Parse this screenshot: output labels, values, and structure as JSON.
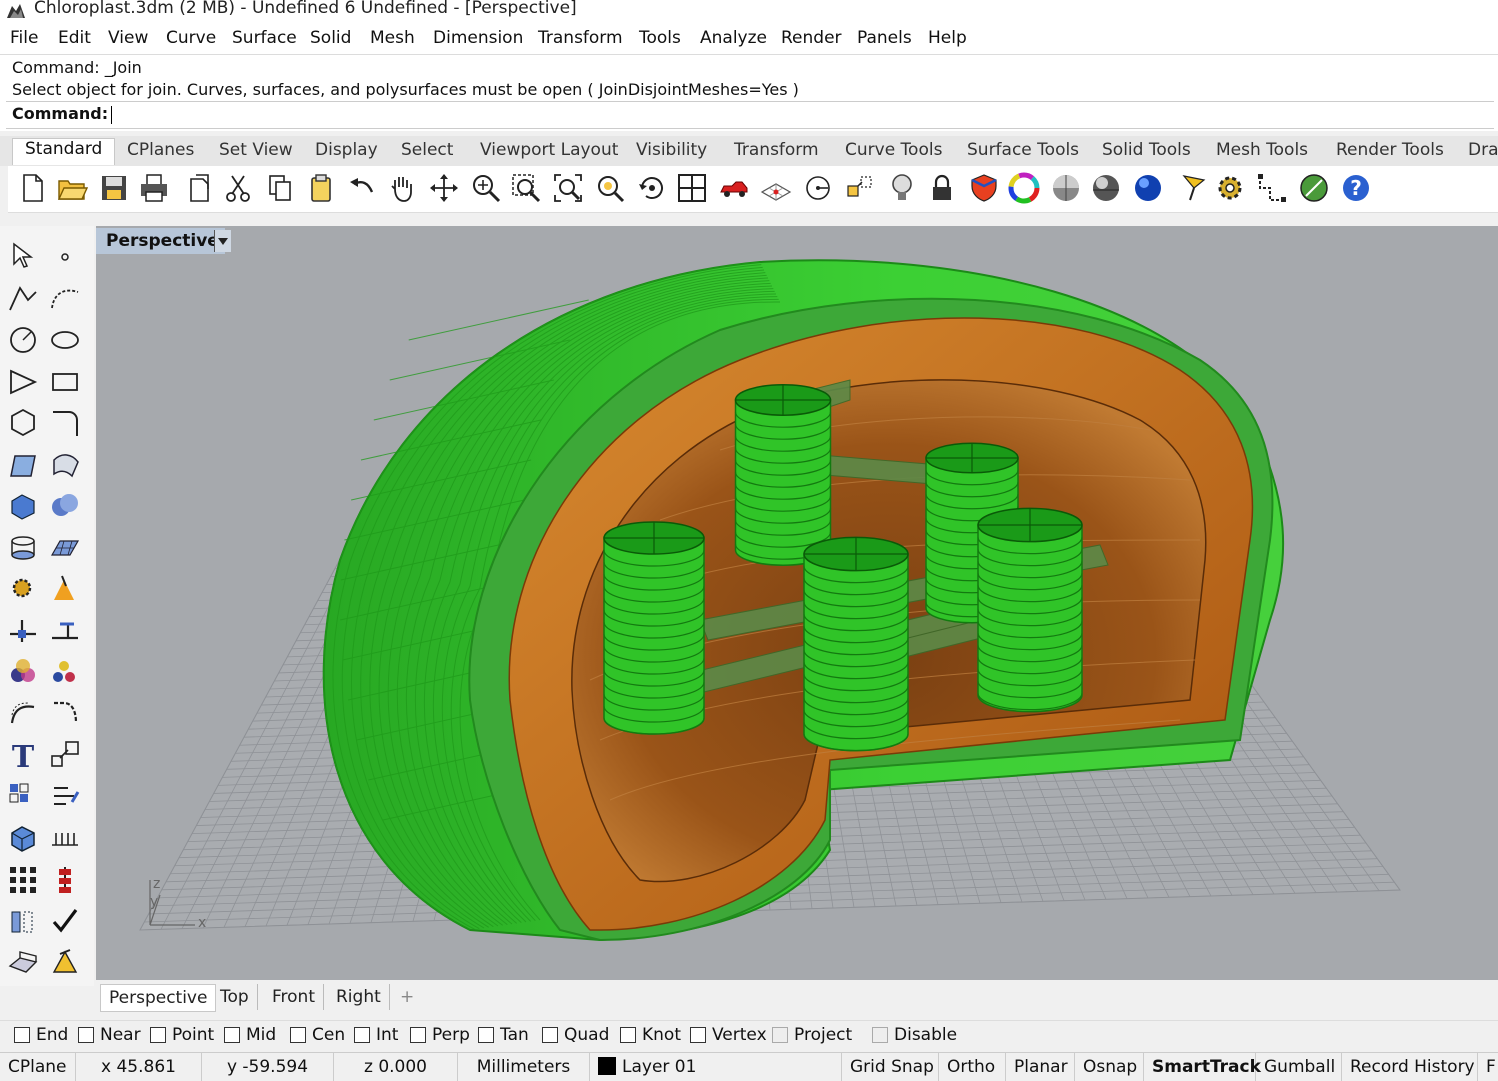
{
  "window": {
    "title": "Chloroplast.3dm (2 MB) - Undefined 6 Undefined - [Perspective]"
  },
  "menu": [
    "File",
    "Edit",
    "View",
    "Curve",
    "Surface",
    "Solid",
    "Mesh",
    "Dimension",
    "Transform",
    "Tools",
    "Analyze",
    "Render",
    "Panels",
    "Help"
  ],
  "command": {
    "history_1": "Command: _Join",
    "history_2": "Select object for join.   Curves, surfaces, and polysurfaces must be open ( JoinDisjointMeshes=Yes )",
    "prompt": "Command:"
  },
  "toolbar_tabs": [
    "Standard",
    "CPlanes",
    "Set View",
    "Display",
    "Select",
    "Viewport Layout",
    "Visibility",
    "Transform",
    "Curve Tools",
    "Surface Tools",
    "Solid Tools",
    "Mesh Tools",
    "Render Tools",
    "Draf"
  ],
  "toolbar_icons": [
    "new-icon",
    "open-icon",
    "save-icon",
    "print-icon",
    "import-icon",
    "cut-icon",
    "copy-icon",
    "paste-icon",
    "undo-icon",
    "pan-hand-icon",
    "rotate-view-icon",
    "zoom-icon",
    "zoom-window-icon",
    "zoom-extents-icon",
    "zoom-selected-icon",
    "rotate-camera-icon",
    "four-viewports-icon",
    "car-icon",
    "grid-icon",
    "circle-point-icon",
    "snap-icon",
    "lightbulb-icon",
    "lock-icon",
    "shield-icon",
    "color-wheel-icon",
    "shaded-sphere-icon",
    "rendered-sphere-icon",
    "blue-sphere-icon",
    "flag-icon",
    "gear-icon",
    "dimension-icon",
    "globe-icon",
    "help-icon"
  ],
  "left_tools": [
    "select-icon",
    "point-icon",
    "polyline-icon",
    "curve-icon",
    "circle-icon",
    "ellipse-icon",
    "polygon-icon",
    "rectangle-icon",
    "hexagon-icon",
    "fillet-icon",
    "surface-icon",
    "loft-icon",
    "box-icon",
    "sphere-union-icon",
    "cylinder-icon",
    "mesh-icon",
    "explode-icon",
    "trim-icon",
    "split-icon",
    "extend-icon",
    "boolean-icon",
    "group-icon",
    "offset-icon",
    "chamfer-icon",
    "text-icon",
    "scale-icon",
    "array-icon",
    "align-icon",
    "block-icon",
    "dimension-icon",
    "grid-array-icon",
    "distribute-icon",
    "mirror-icon",
    "check-icon",
    "solid-icon",
    "rotate-3d-icon"
  ],
  "viewport": {
    "label": "Perspective",
    "axis_x": "x",
    "axis_y": "y",
    "axis_z": "z",
    "colors": {
      "background": "#a6a9ad",
      "membrane": "#36c230",
      "inner": "#c4701a",
      "grana": "#34cc2c"
    }
  },
  "view_tabs": [
    "Perspective",
    "Top",
    "Front",
    "Right"
  ],
  "view_tab_add": "+",
  "osnaps": [
    {
      "label": "End",
      "checked": false
    },
    {
      "label": "Near",
      "checked": false
    },
    {
      "label": "Point",
      "checked": false
    },
    {
      "label": "Mid",
      "checked": false
    },
    {
      "label": "Cen",
      "checked": false
    },
    {
      "label": "Int",
      "checked": false
    },
    {
      "label": "Perp",
      "checked": false
    },
    {
      "label": "Tan",
      "checked": false
    },
    {
      "label": "Quad",
      "checked": false
    },
    {
      "label": "Knot",
      "checked": false
    },
    {
      "label": "Vertex",
      "checked": false
    },
    {
      "label": "Project",
      "checked": false,
      "disabled": true
    },
    {
      "label": "Disable",
      "checked": false,
      "disabled": true
    }
  ],
  "status": {
    "cplane": "CPlane",
    "x": "x 45.861",
    "y": "y -59.594",
    "z": "z 0.000",
    "units": "Millimeters",
    "layer": "Layer 01",
    "grid_snap": "Grid Snap",
    "ortho": "Ortho",
    "planar": "Planar",
    "osnap": "Osnap",
    "smarttrack": "SmartTrack",
    "gumball": "Gumball",
    "record_history": "Record History",
    "filter": "F"
  }
}
